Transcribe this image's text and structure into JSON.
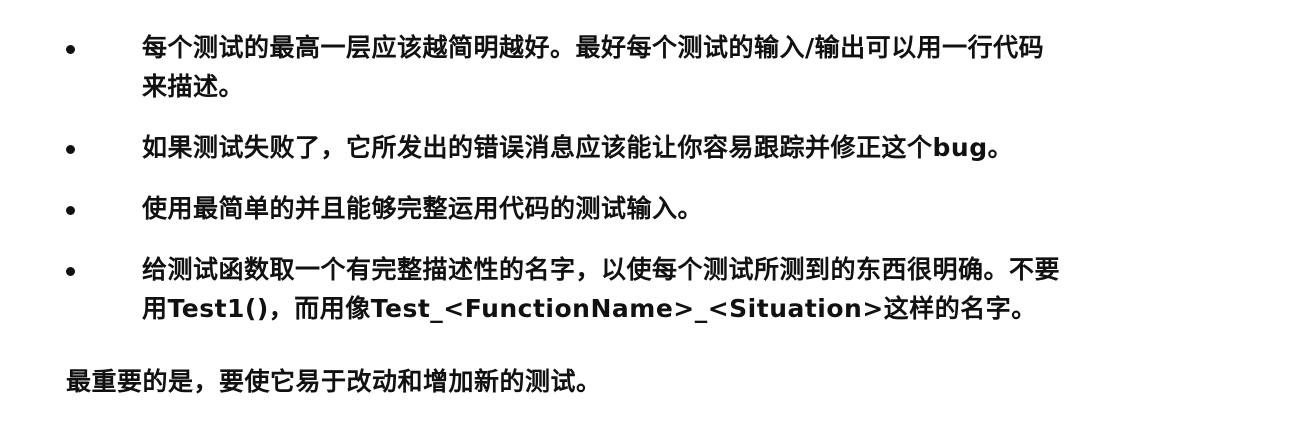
{
  "bullets": [
    {
      "text": "每个测试的最高一层应该越简明越好。最好每个测试的输入/输出可以用一行代码\n来描述。"
    },
    {
      "text": "如果测试失败了，它所发出的错误消息应该能让你容易跟踪并修正这个bug。"
    },
    {
      "text": "使用最简单的并且能够完整运用代码的测试输入。"
    },
    {
      "text": "给测试函数取一个有完整描述性的名字，以使每个测试所测到的东西很明确。不要\n用Test1()，而用像Test_<FunctionName>_<Situation>这样的名字。"
    }
  ],
  "summary": "最重要的是，要使它易于改动和增加新的测试。"
}
